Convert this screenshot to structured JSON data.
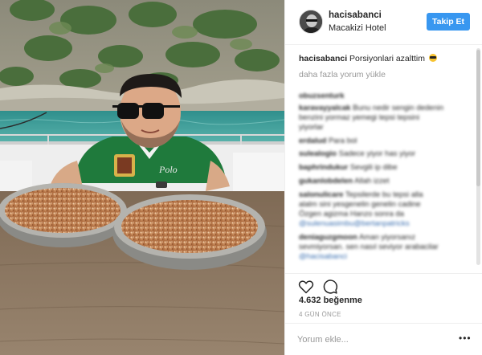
{
  "post": {
    "photo_icon": "post-photo",
    "owner": "hacisabanci",
    "location": "Macakizi Hotel",
    "follow_label": "Takip Et",
    "caption_user": "hacisabanci",
    "caption_text": "Porsiyonlari azalttim",
    "caption_emoji": "sunglasses-emoji",
    "load_more": "daha fazla yorum yükle",
    "comments": [
      {
        "user": "obuzsenturk",
        "text": ""
      },
      {
        "user": "karavayyalcak",
        "text": "Bunu nedir sengin dedenin"
      },
      {
        "user": "",
        "text": "benzini yormaz yemegi tepsi tepsini"
      },
      {
        "user": "",
        "text": "yiyorlar"
      },
      {
        "user": "erdalud",
        "text": "Para bol"
      },
      {
        "user": "sulealogio",
        "text": "Sadece yiyor has yiyor"
      },
      {
        "user": "baphrindukur",
        "text": "Sevgili ip dibe"
      },
      {
        "user": "gukanlobdelen",
        "text": "Allah izzet"
      },
      {
        "user": "salonulicare",
        "text": "Tepsilerde bu tepsi alla"
      },
      {
        "user": "",
        "text": "alalm sini yesgenelin genelin cadine"
      },
      {
        "user": "",
        "text": "Özgen agizma Hanzo sonra da"
      },
      {
        "user": "",
        "text": "@sulenuasimbu@bertanpatricks"
      },
      {
        "user": "deniaguzgmoon",
        "text": "Aman yiyorsanız"
      },
      {
        "user": "",
        "text": "sevmiyorsan. sen nasıl seviyor arabacilar"
      },
      {
        "user": "",
        "text": "@hacisabanci"
      }
    ],
    "like_icon": "heart-icon",
    "comment_icon": "comment-icon",
    "likes": "4.632 beğenme",
    "time": "4 GÜN ÖNCE",
    "comment_placeholder": "Yorum ekle...",
    "more_label": "•••"
  }
}
